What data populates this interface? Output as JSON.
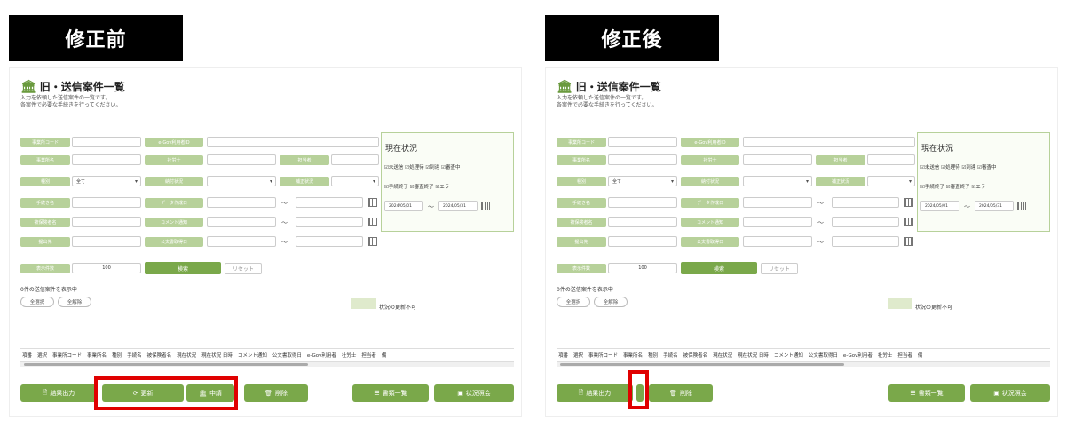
{
  "before": {
    "header": "修正前",
    "bottom_buttons": [
      "結果出力",
      "更新",
      "申請",
      "削除",
      "書類一覧",
      "状況照会"
    ]
  },
  "after": {
    "header": "修正後",
    "bottom_buttons": [
      "結果出力",
      "削除",
      "書類一覧",
      "状況照会"
    ]
  },
  "screen": {
    "title": "旧・送信案件一覧",
    "desc_line1": "入力を依頼した送信案件の一覧です。",
    "desc_line2": "各案件で必要な手続きを行ってください。",
    "labels": {
      "office_code": "事業所コード",
      "egov_user_id": "e-Gov利用者ID",
      "office_name": "事業所名",
      "labor_consultant": "社労士",
      "staff": "担当者",
      "type": "種別",
      "input_status": "納付状況",
      "correction_status": "補正状況",
      "procedure_name": "手続き名",
      "data_created_date": "データ作成日",
      "insured_name": "被保険者名",
      "comment_notice": "コメント通知",
      "submit_to": "提出先",
      "official_doc_date": "公文書取得日",
      "display_count": "表示件数"
    },
    "type_value": "全て",
    "display_count_value": "100",
    "search_button": "検索",
    "reset_button": "リセット",
    "status": {
      "title": "現在状況",
      "row1": "☑未送信 ☑処理待 ☑到達 ☑審査中",
      "row2": "☑手続終了 ☑審査終了 ☑エラー",
      "date_from": "2024/05/01",
      "date_to": "2024/05/31"
    },
    "result_count": "0件の送信案件を表示中",
    "select_all": "全選択",
    "deselect_all": "全解除",
    "legend_before": "状況の更新不可",
    "legend_after": "状況の更新不可",
    "columns": [
      "項番",
      "選択",
      "事業所コード",
      "事業所名",
      "種別",
      "手続名",
      "被保険者名",
      "現在状況",
      "現在状況 日時",
      "コメント通知",
      "公文書取得日",
      "e-Gov利用者",
      "社労士",
      "担当者",
      "備"
    ]
  }
}
